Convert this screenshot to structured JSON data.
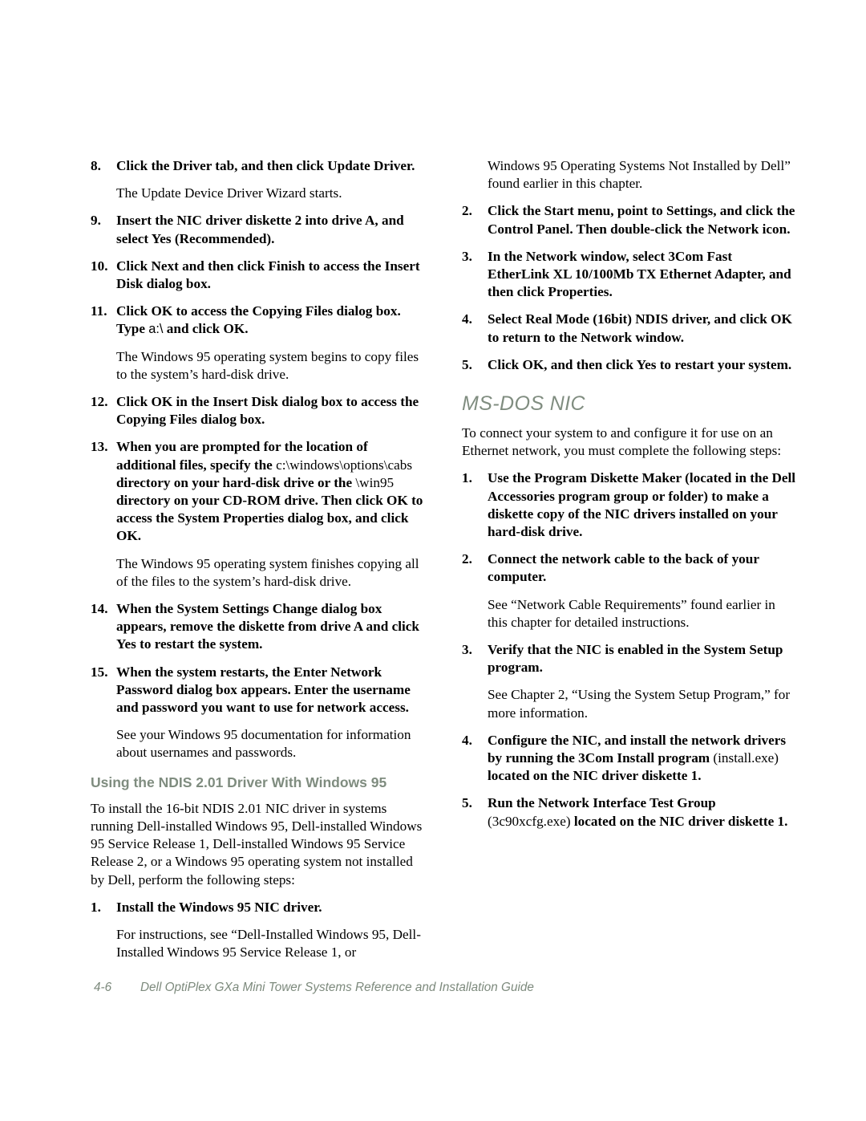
{
  "document": {
    "page_number": "4-6",
    "footer_title": "Dell OptiPlex GXa Mini Tower Systems Reference and Installation Guide",
    "heading_color": "#808d80",
    "body_color": "#000000",
    "background": "#ffffff"
  },
  "left_column": {
    "blocks": [
      {
        "kind": "step",
        "number": "8.",
        "parts": [
          {
            "text": "Click the Driver tab, and then click Update Driver.",
            "style": "bold"
          }
        ]
      },
      {
        "kind": "para",
        "indented": true,
        "text": "The Update Device Driver Wizard starts."
      },
      {
        "kind": "step",
        "number": "9.",
        "parts": [
          {
            "text": "Insert the NIC driver diskette 2 into drive A, and select Yes (Recommended).",
            "style": "bold"
          }
        ]
      },
      {
        "kind": "step",
        "number": "10.",
        "parts": [
          {
            "text": "Click Next and then click Finish to access the Insert Disk dialog box.",
            "style": "bold"
          }
        ]
      },
      {
        "kind": "step",
        "number": "11.",
        "parts": [
          {
            "text": "Click OK to access the Copying Files dialog box. Type ",
            "style": "bold"
          },
          {
            "text": "a:\\",
            "style": "mono"
          },
          {
            "text": " and click OK.",
            "style": "bold"
          }
        ]
      },
      {
        "kind": "para",
        "indented": true,
        "text": "The Windows 95 operating system begins to copy files to the system’s hard-disk drive."
      },
      {
        "kind": "step",
        "number": "12.",
        "parts": [
          {
            "text": "Click OK in the Insert Disk dialog box to access the Copying Files dialog box.",
            "style": "bold"
          }
        ]
      },
      {
        "kind": "step",
        "number": "13.",
        "parts": [
          {
            "text": "When you are prompted for the location of additional files, specify the ",
            "style": "bold"
          },
          {
            "text": "c:\\windows\\options\\cabs",
            "style": "regular"
          },
          {
            "text": " directory on your hard-disk drive or the ",
            "style": "bold"
          },
          {
            "text": "\\win95",
            "style": "regular"
          },
          {
            "text": " directory on your CD-ROM drive. Then click OK to access the System Properties dialog box, and click OK.",
            "style": "bold"
          }
        ]
      },
      {
        "kind": "para",
        "indented": true,
        "text": "The Windows 95 operating system finishes copying all of the files to the system’s hard-disk drive."
      },
      {
        "kind": "step",
        "number": "14.",
        "parts": [
          {
            "text": "When the System Settings Change dialog box appears, remove the diskette from drive A and click Yes to restart the system.",
            "style": "bold"
          }
        ]
      },
      {
        "kind": "step",
        "number": "15.",
        "parts": [
          {
            "text": "When the system restarts, the Enter Network Password dialog box appears. Enter the username and password you want to use for network access.",
            "style": "bold"
          }
        ]
      },
      {
        "kind": "para",
        "indented": true,
        "text": "See your Windows 95 documentation for information about usernames and passwords."
      },
      {
        "kind": "h2",
        "text": "Using the NDIS 2.01 Driver With Windows 95"
      },
      {
        "kind": "para",
        "indented": false,
        "text": "To install the 16-bit NDIS 2.01 NIC driver in systems running Dell-installed Windows 95, Dell-installed Windows 95 Service Release 1, Dell-installed Windows 95 Service Release 2, or a Windows 95 operating system not installed by Dell, perform the following steps:"
      },
      {
        "kind": "step",
        "number": "1.",
        "parts": [
          {
            "text": "Install the Windows 95 NIC driver.",
            "style": "bold"
          }
        ]
      },
      {
        "kind": "para",
        "indented": true,
        "text": "For instructions, see “Dell-Installed Windows 95, Dell-Installed Windows 95 Service Release 1, or"
      }
    ]
  },
  "right_column": {
    "blocks": [
      {
        "kind": "para",
        "indented": true,
        "text": "Windows 95 Operating Systems Not Installed by Dell” found earlier in this chapter."
      },
      {
        "kind": "step",
        "number": "2.",
        "parts": [
          {
            "text": "Click the Start menu, point to Settings, and click the Control Panel. Then double-click the Network icon.",
            "style": "bold"
          }
        ]
      },
      {
        "kind": "step",
        "number": "3.",
        "parts": [
          {
            "text": "In the Network window, select 3Com Fast EtherLink XL 10/100Mb TX Ethernet Adapter, and then click Properties.",
            "style": "bold"
          }
        ]
      },
      {
        "kind": "step",
        "number": "4.",
        "parts": [
          {
            "text": "Select Real Mode (16bit) NDIS driver, and click OK to return to the Network window.",
            "style": "bold"
          }
        ]
      },
      {
        "kind": "step",
        "number": "5.",
        "parts": [
          {
            "text": "Click OK, and then click Yes to restart your system.",
            "style": "bold"
          }
        ]
      },
      {
        "kind": "h1",
        "text": "MS-DOS NIC"
      },
      {
        "kind": "para",
        "indented": false,
        "text": "To connect your system to and configure it for use on an Ethernet network, you must complete the following steps:"
      },
      {
        "kind": "step",
        "number": "1.",
        "parts": [
          {
            "text": "Use the Program Diskette Maker (located in the Dell Accessories program group or folder) to make a diskette copy of the NIC drivers installed on your hard-disk drive.",
            "style": "bold"
          }
        ]
      },
      {
        "kind": "step",
        "number": "2.",
        "parts": [
          {
            "text": "Connect the network cable to the back of your computer.",
            "style": "bold"
          }
        ]
      },
      {
        "kind": "para",
        "indented": true,
        "text": "See “Network Cable Requirements” found earlier in this chapter for detailed instructions."
      },
      {
        "kind": "step",
        "number": "3.",
        "parts": [
          {
            "text": "Verify that the NIC is enabled in the System Setup program.",
            "style": "bold"
          }
        ]
      },
      {
        "kind": "para",
        "indented": true,
        "text": "See Chapter 2, “Using the System Setup Program,” for more information."
      },
      {
        "kind": "step",
        "number": "4.",
        "parts": [
          {
            "text": "Configure the NIC, and install the network drivers by running the 3Com Install program ",
            "style": "bold"
          },
          {
            "text": "(install.exe)",
            "style": "regular"
          },
          {
            "text": " located on the NIC driver diskette 1.",
            "style": "bold"
          }
        ]
      },
      {
        "kind": "step",
        "number": "5.",
        "parts": [
          {
            "text": "Run the Network Interface Test Group ",
            "style": "bold"
          },
          {
            "text": "(3c90xcfg.exe)",
            "style": "regular"
          },
          {
            "text": " located on the NIC driver diskette 1.",
            "style": "bold"
          }
        ]
      }
    ]
  }
}
